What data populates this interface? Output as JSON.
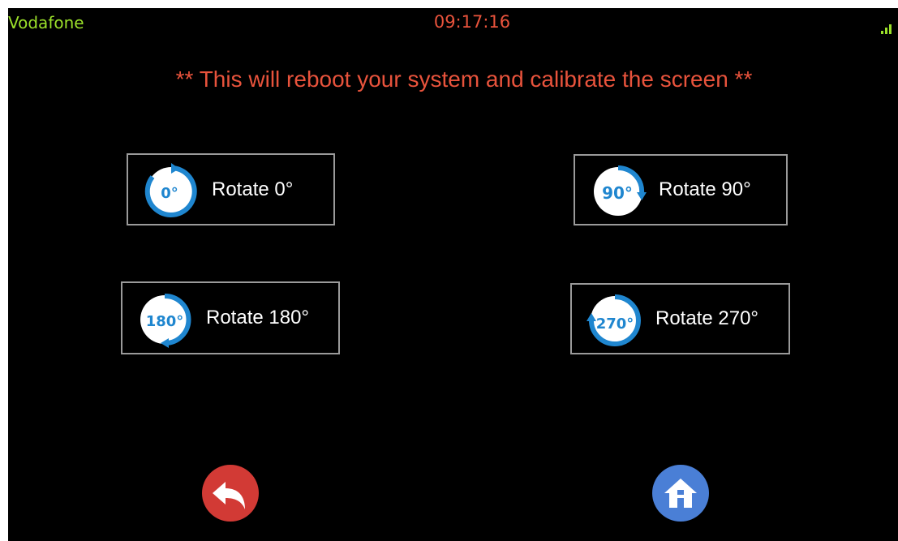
{
  "status_bar": {
    "carrier": "Vodafone",
    "time": "09:17:16",
    "signal_icon": "signal-bars-icon"
  },
  "warning_text": "** This will reboot your system and calibrate the screen **",
  "rotations": [
    {
      "badge": "0°",
      "label": "Rotate 0°"
    },
    {
      "badge": "90°",
      "label": "Rotate 90°"
    },
    {
      "badge": "180°",
      "label": "Rotate 180°"
    },
    {
      "badge": "270°",
      "label": "Rotate 270°"
    }
  ],
  "navigation": {
    "back_icon": "back-arrow-icon",
    "home_icon": "home-icon"
  },
  "colors": {
    "carrier": "#9be02a",
    "accent_red": "#e8533c",
    "icon_blue": "#1f86cf",
    "back_red": "#d23a35",
    "home_blue": "#4a7fd6"
  }
}
